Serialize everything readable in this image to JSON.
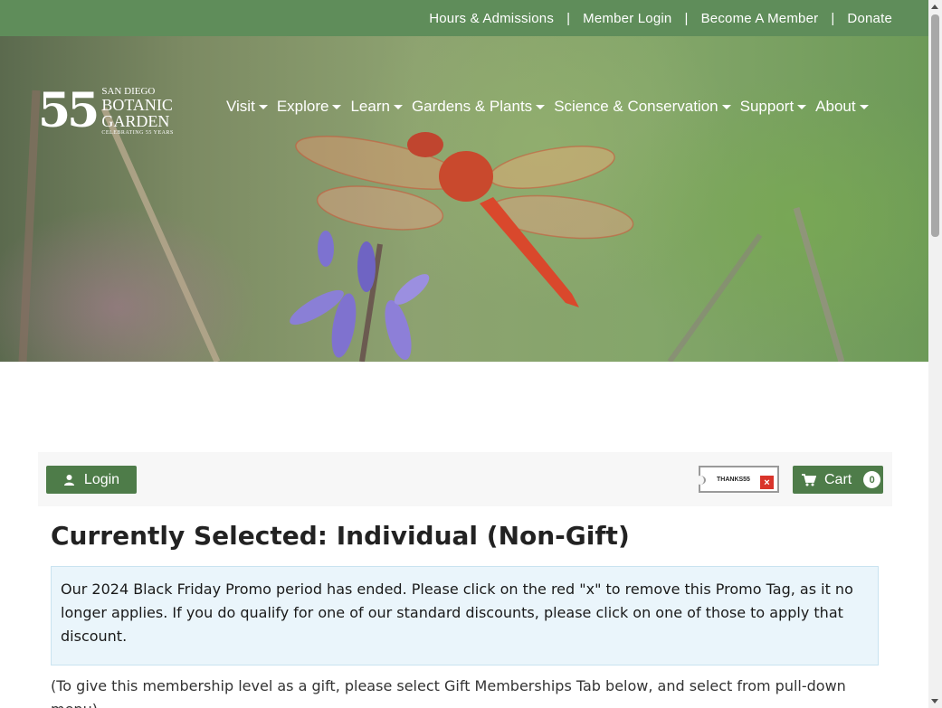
{
  "utility_nav": {
    "items": [
      "Hours & Admissions",
      "Member Login",
      "Become A Member",
      "Donate"
    ],
    "separator": "|"
  },
  "logo": {
    "number": "55",
    "line1": "SAN DIEGO",
    "line2": "BOTANIC",
    "line3": "GARDEN",
    "line4": "CELEBRATING 55 YEARS"
  },
  "main_nav": {
    "items": [
      "Visit",
      "Explore",
      "Learn",
      "Gardens & Plants",
      "Science & Conservation",
      "Support",
      "About"
    ]
  },
  "toolbar": {
    "login_label": "Login",
    "promo_code": "THANKS55",
    "promo_remove": "×",
    "cart_label": "Cart",
    "cart_count": "0"
  },
  "content": {
    "heading_prefix": "Currently Selected: ",
    "heading_level": "Individual (Non-Gift)",
    "alert_text": "Our 2024 Black Friday Promo period has ended. Please click on the red \"x\" to remove this Promo Tag, as it no longer applies. If you do qualify for one of our standard discounts, please click on one of those to apply that discount.",
    "gift_note": "(To give this membership level as a gift, please select Gift Memberships Tab below, and select from pull-down menu)"
  },
  "colors": {
    "brand_green": "#5f8d5a",
    "button_green": "#4e7c49",
    "alert_bg": "#eaf5fb",
    "promo_remove_red": "#d9342b"
  }
}
